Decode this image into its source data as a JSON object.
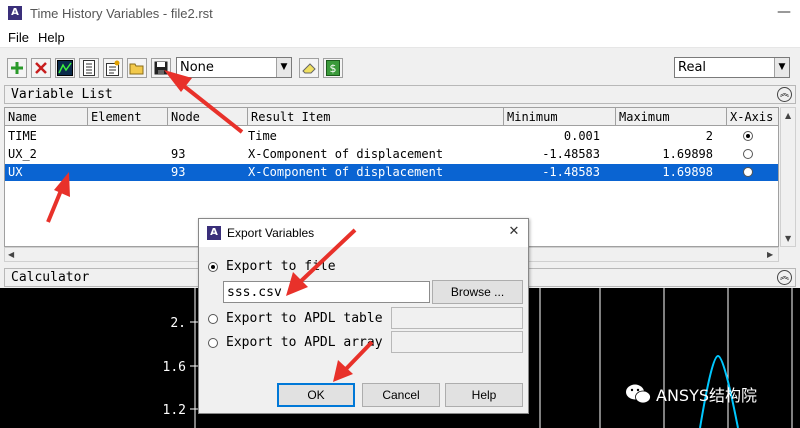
{
  "window": {
    "title": "Time History Variables - file2.rst",
    "app_icon": "A",
    "minimize_glyph": "—"
  },
  "menu": [
    "File",
    "Help"
  ],
  "toolbar": {
    "icons": [
      "add-icon",
      "delete-icon",
      "graph-icon",
      "list-icon",
      "properties-icon",
      "open-folder-icon",
      "save-icon",
      "clear-icon",
      "money-icon"
    ],
    "result_select": "None",
    "part_select": "Real"
  },
  "variable_list": {
    "title": "Variable List",
    "columns": [
      "Name",
      "Element",
      "Node",
      "Result Item",
      "Minimum",
      "Maximum",
      "X-Axis"
    ],
    "rows": [
      {
        "name": "TIME",
        "element": "",
        "node": "",
        "result_item": "Time",
        "minimum": "0.001",
        "maximum": "2",
        "x_axis": true,
        "selected": false
      },
      {
        "name": "UX_2",
        "element": "",
        "node": "93",
        "result_item": "X-Component of displacement",
        "minimum": "-1.48583",
        "maximum": "1.69898",
        "x_axis": false,
        "selected": false
      },
      {
        "name": "UX",
        "element": "",
        "node": "93",
        "result_item": "X-Component of displacement",
        "minimum": "-1.48583",
        "maximum": "1.69898",
        "x_axis": false,
        "selected": true
      }
    ]
  },
  "calculator": {
    "title": "Calculator"
  },
  "plot": {
    "y_ticks": [
      "2.",
      "1.6",
      "1.2"
    ],
    "background": "#000000",
    "curve_color": "#00c8ff"
  },
  "dialog": {
    "title": "Export Variables",
    "options": [
      {
        "label": "Export to file",
        "selected": true
      },
      {
        "label": "Export to APDL table",
        "selected": false
      },
      {
        "label": "Export to APDL array",
        "selected": false
      }
    ],
    "file_value": "sss.csv",
    "browse_label": "Browse ...",
    "ok_label": "OK",
    "cancel_label": "Cancel",
    "help_label": "Help"
  },
  "watermark": "ANSYS结构院",
  "colors": {
    "selection": "#0a64d2",
    "arrow": "#e8312a",
    "focus": "#0078d7"
  }
}
